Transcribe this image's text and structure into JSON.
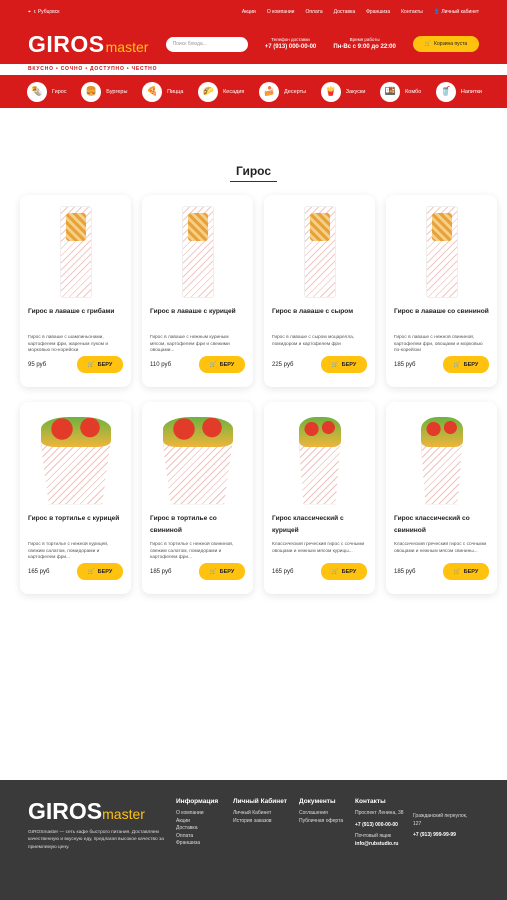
{
  "topbar": {
    "city": "г. Рубцовск",
    "links": [
      "Акции",
      "О компании",
      "Оплата",
      "Доставка",
      "Франшиза",
      "Контакты"
    ],
    "account": "Личный кабинет"
  },
  "header": {
    "logo_main": "GIROS",
    "logo_sub": "master",
    "search_placeholder": "Поиск блюда...",
    "phone_label": "Телефон доставки",
    "phone": "+7 (913) 000-00-00",
    "hours_label": "Время работы",
    "hours": "Пн-Вс с 9:00 до 22:00",
    "cart_label": "Корзина пуста"
  },
  "slogan": "ВКУСНО • СОЧНО • ДОСТУПНО • ЧЕСТНО",
  "categories": [
    {
      "label": "Гирос",
      "icon": "gyro-icon"
    },
    {
      "label": "Бургеры",
      "icon": "burger-icon"
    },
    {
      "label": "Пицца",
      "icon": "pizza-icon"
    },
    {
      "label": "Кесадия",
      "icon": "quesadilla-icon"
    },
    {
      "label": "Десерты",
      "icon": "dessert-icon"
    },
    {
      "label": "Закуски",
      "icon": "snack-icon"
    },
    {
      "label": "Комбо",
      "icon": "combo-icon"
    },
    {
      "label": "Напитки",
      "icon": "drink-icon"
    }
  ],
  "section_title": "Гирос",
  "products": [
    {
      "name": "Гирос в лаваше с грибами",
      "desc": "Гирос в лаваше с шампиньонами, картофелем фри, жареным луком и морковью по-корейски",
      "price": "95 руб",
      "buy": "БЕРУ",
      "img": "wrap"
    },
    {
      "name": "Гирос в лаваше с курицей",
      "desc": "Гирос в лаваше с нежным куриным мясом, картофелем фри и свежими овощами...",
      "price": "110 руб",
      "buy": "БЕРУ",
      "img": "wrap"
    },
    {
      "name": "Гирос в лаваше с сыром",
      "desc": "Гирос в лаваше с сыром моцарелла, помидором и картофелем фри",
      "price": "225 руб",
      "buy": "БЕРУ",
      "img": "wrap"
    },
    {
      "name": "Гирос в лаваше со свининой",
      "desc": "Гирос в лаваше с нежной свининой, картофелем фри, овощами и морковью по-корейски",
      "price": "185 руб",
      "buy": "БЕРУ",
      "img": "wrap"
    },
    {
      "name": "Гирос в тортилье с курицей",
      "desc": "Гирос в тортилье с нежной курицей, свежим салатом, помидорами и картофелем фри...",
      "price": "165 руб",
      "buy": "БЕРУ",
      "img": "cone"
    },
    {
      "name": "Гирос в тортилье со свининой",
      "desc": "Гирос в тортилье с нежной свининой, свежим салатом, помидорами и картофелем фри...",
      "price": "185 руб",
      "buy": "БЕРУ",
      "img": "cone"
    },
    {
      "name": "Гирос классический с курицей",
      "desc": "Классический греческий гирос с сочными овощами и нежным мясом курицы...",
      "price": "165 руб",
      "buy": "БЕРУ",
      "img": "cone-narrow"
    },
    {
      "name": "Гирос классический со свининой",
      "desc": "Классический греческий гирос с сочными овощами и нежным мясом свинины...",
      "price": "185 руб",
      "buy": "БЕРУ",
      "img": "cone-narrow"
    }
  ],
  "footer": {
    "logo_main": "GIROS",
    "logo_sub": "master",
    "about": "GIROSmaster — сеть кафе быстрого питания. Доставляем качественную и вкусную еду, предлагая высокое качество за приемлемую цену.",
    "info_title": "Информация",
    "info_links": [
      "О компании",
      "Акции",
      "Доставка",
      "Оплата",
      "Франшиза"
    ],
    "account_title": "Личный Кабинет",
    "account_links": [
      "Личный Кабинет",
      "История заказов"
    ],
    "docs_title": "Документы",
    "docs_links": [
      "Соглашения",
      "Публичная оферта"
    ],
    "contacts_title": "Контакты",
    "addr1": "Проспект Ленина, 38",
    "phone1": "+7 (913) 000-00-00",
    "addr2": "Гражданский переулок, 127",
    "phone2": "+7 (913) 999-99-99",
    "mail_label": "Почтовый ящик",
    "mail": "info@rubstudio.ru"
  },
  "colors": {
    "brand_red": "#d71b1b",
    "accent_yellow": "#ffc20e",
    "footer_bg": "#3a3a3a"
  }
}
